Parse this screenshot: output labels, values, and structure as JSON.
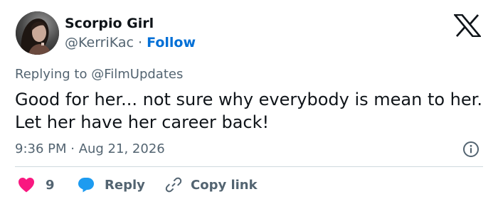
{
  "author": {
    "display_name": "Scorpio Girl",
    "handle": "@KerriKac",
    "separator": "·",
    "follow_label": "Follow"
  },
  "reply_context": "Replying to @FilmUpdates",
  "body": "Good for her... not sure why everybody is mean to her. Let her have her career back!",
  "meta": {
    "timestamp": "9:36 PM · Aug 21, 2026"
  },
  "actions": {
    "like_count": "9",
    "reply_label": "Reply",
    "copy_label": "Copy link"
  },
  "icons": {
    "logo": "x-logo-icon",
    "info": "info-icon",
    "like": "heart-icon",
    "reply": "speech-bubble-icon",
    "copy": "link-icon"
  },
  "colors": {
    "text_primary": "#0f1419",
    "text_secondary": "#536471",
    "follow": "#006fd6",
    "heart": "#f91880",
    "reply_bubble": "#1d9bf0",
    "divider": "#cfd9de"
  }
}
